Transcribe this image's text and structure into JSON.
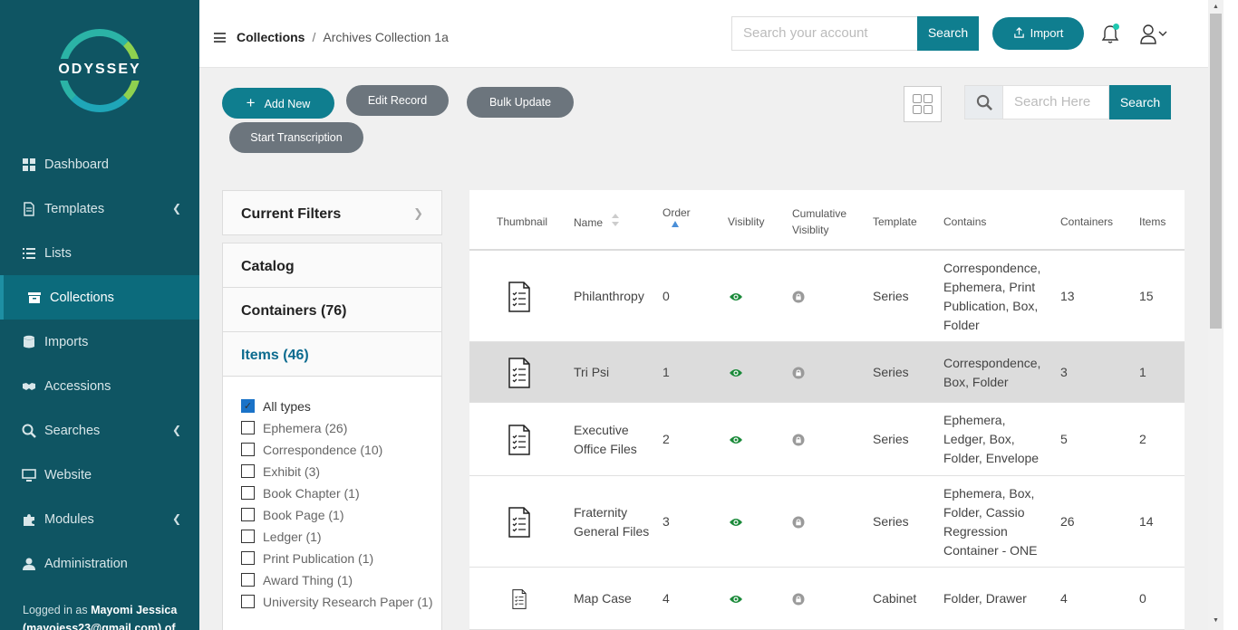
{
  "brand": {
    "logo_text": "ODYSSEY",
    "accent": "#0f7e8f",
    "sidebar_bg": "#0f5563"
  },
  "sidebar": {
    "items": [
      {
        "label": "Dashboard",
        "icon": "dashboard-icon",
        "chevron": false
      },
      {
        "label": "Templates",
        "icon": "document-icon",
        "chevron": true
      },
      {
        "label": "Lists",
        "icon": "list-icon",
        "chevron": false
      },
      {
        "label": "Collections",
        "icon": "archive-box-icon",
        "chevron": false,
        "active": true
      },
      {
        "label": "Imports",
        "icon": "database-icon",
        "chevron": false
      },
      {
        "label": "Accessions",
        "icon": "handshake-icon",
        "chevron": false
      },
      {
        "label": "Searches",
        "icon": "search-doc-icon",
        "chevron": true
      },
      {
        "label": "Website",
        "icon": "monitor-icon",
        "chevron": false
      },
      {
        "label": "Modules",
        "icon": "puzzle-icon",
        "chevron": true
      },
      {
        "label": "Administration",
        "icon": "user-icon",
        "chevron": false
      }
    ],
    "logged_prefix": "Logged in as",
    "logged_name": "Mayomi Jessica",
    "logged_email": "(mayojess23@gmail.com) of"
  },
  "header": {
    "breadcrumb_root": "Collections",
    "breadcrumb_sep": "/",
    "breadcrumb_current": "Archives Collection 1a",
    "search_placeholder": "Search your account",
    "search_button": "Search",
    "import_button": "Import"
  },
  "toolbar": {
    "add_new": "Add New",
    "add_icon": "+",
    "edit_record": "Edit Record",
    "bulk_update": "Bulk Update",
    "start_transcription": "Start Transcription",
    "search_placeholder": "Search Here",
    "search_button": "Search"
  },
  "filters": {
    "current_filters": "Current Filters",
    "catalog": "Catalog",
    "containers": "Containers (76)",
    "items": "Items (46)",
    "types": [
      {
        "label": "All types",
        "checked": true
      },
      {
        "label": "Ephemera (26)",
        "checked": false
      },
      {
        "label": "Correspondence (10)",
        "checked": false
      },
      {
        "label": "Exhibit (3)",
        "checked": false
      },
      {
        "label": "Book Chapter (1)",
        "checked": false
      },
      {
        "label": "Book Page (1)",
        "checked": false
      },
      {
        "label": "Ledger (1)",
        "checked": false
      },
      {
        "label": "Print Publication (1)",
        "checked": false
      },
      {
        "label": "Award Thing (1)",
        "checked": false
      },
      {
        "label": "University Research Paper (1)",
        "checked": false
      }
    ]
  },
  "table": {
    "headers": {
      "thumbnail": "Thumbnail",
      "name": "Name",
      "order": "Order",
      "visibility": "Visiblity",
      "cumulative_1": "Cumulative",
      "cumulative_2": "Visiblity",
      "template": "Template",
      "contains": "Contains",
      "containers": "Containers",
      "items": "Items"
    },
    "rows": [
      {
        "name": "Philanthropy",
        "order": "0",
        "template": "Series",
        "contains": "Correspondence, Ephemera, Print Publication, Box, Folder",
        "containers": "13",
        "items": "15",
        "selected": false
      },
      {
        "name": "Tri Psi",
        "order": "1",
        "template": "Series",
        "contains": "Correspondence, Box, Folder",
        "containers": "3",
        "items": "1",
        "selected": true
      },
      {
        "name": "Executive Office Files",
        "order": "2",
        "template": "Series",
        "contains": "Ephemera, Ledger, Box, Folder, Envelope",
        "containers": "5",
        "items": "2",
        "selected": false
      },
      {
        "name": "Fraternity General Files",
        "order": "3",
        "template": "Series",
        "contains": "Ephemera, Box, Folder, Cassio Regression Container - ONE",
        "containers": "26",
        "items": "14",
        "selected": false
      },
      {
        "name": "Map Case",
        "order": "4",
        "template": "Cabinet",
        "contains": "Folder, Drawer",
        "containers": "4",
        "items": "0",
        "selected": false
      }
    ]
  }
}
